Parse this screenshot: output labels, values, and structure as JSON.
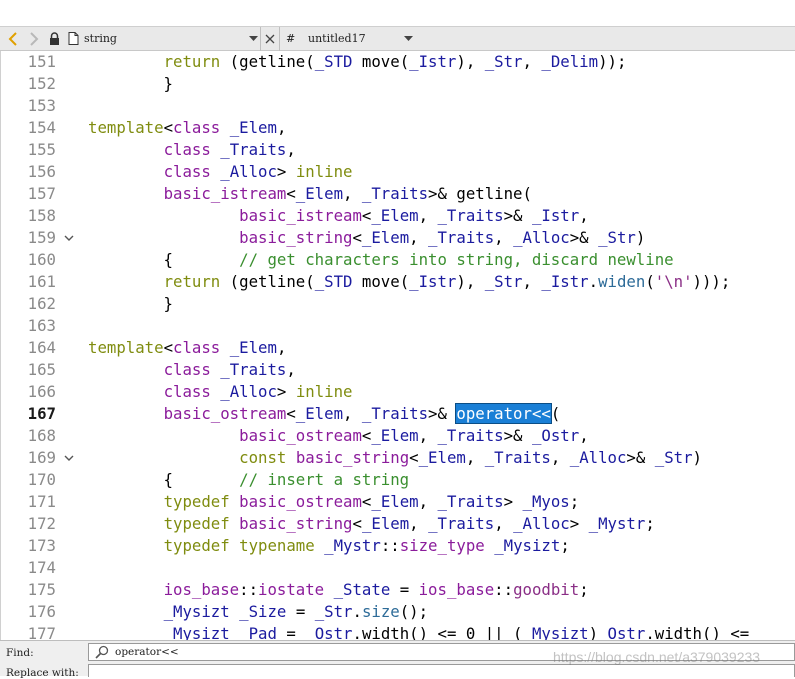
{
  "colors": {
    "keyword": "#7f8c0f",
    "type": "#8b1c9b",
    "identifier": "#1b1b9f",
    "comment": "#3a8f2f",
    "string": "#8a2e86",
    "method": "#2d6b98",
    "plain": "#000000",
    "selection": "#1a7fd6"
  },
  "toolbar": {
    "back_icon": "chevron-left-icon",
    "forward_icon": "chevron-right-icon",
    "lock_icon": "lock-icon",
    "file_icon": "file-icon",
    "file_name": "string",
    "symbol_prefix": "#",
    "symbol_name": "untitled17"
  },
  "editor": {
    "lines": [
      {
        "n": "151",
        "fold": "",
        "tokens": [
          [
            "        ",
            "p"
          ],
          [
            "return",
            "k"
          ],
          [
            " (getline(",
            "p"
          ],
          [
            "_STD",
            "i"
          ],
          [
            " move(",
            "p"
          ],
          [
            "_Istr",
            "i"
          ],
          [
            "), ",
            "p"
          ],
          [
            "_Str",
            "i"
          ],
          [
            ", ",
            "p"
          ],
          [
            "_Delim",
            "i"
          ],
          [
            "));",
            "p"
          ]
        ]
      },
      {
        "n": "152",
        "fold": "",
        "tokens": [
          [
            "        }",
            "p"
          ]
        ]
      },
      {
        "n": "153",
        "fold": "",
        "tokens": []
      },
      {
        "n": "154",
        "fold": "",
        "tokens": [
          [
            "template",
            "k"
          ],
          [
            "<",
            "p"
          ],
          [
            "class",
            "t"
          ],
          [
            " ",
            "p"
          ],
          [
            "_Elem",
            "i"
          ],
          [
            ",",
            "p"
          ]
        ]
      },
      {
        "n": "155",
        "fold": "",
        "tokens": [
          [
            "        ",
            "p"
          ],
          [
            "class",
            "t"
          ],
          [
            " ",
            "p"
          ],
          [
            "_Traits",
            "i"
          ],
          [
            ",",
            "p"
          ]
        ]
      },
      {
        "n": "156",
        "fold": "",
        "tokens": [
          [
            "        ",
            "p"
          ],
          [
            "class",
            "t"
          ],
          [
            " ",
            "p"
          ],
          [
            "_Alloc",
            "i"
          ],
          [
            "> ",
            "p"
          ],
          [
            "inline",
            "k"
          ]
        ]
      },
      {
        "n": "157",
        "fold": "",
        "tokens": [
          [
            "        ",
            "p"
          ],
          [
            "basic_istream",
            "t"
          ],
          [
            "<",
            "p"
          ],
          [
            "_Elem",
            "i"
          ],
          [
            ", ",
            "p"
          ],
          [
            "_Traits",
            "i"
          ],
          [
            ">& getline(",
            "p"
          ]
        ]
      },
      {
        "n": "158",
        "fold": "",
        "tokens": [
          [
            "                ",
            "p"
          ],
          [
            "basic_istream",
            "t"
          ],
          [
            "<",
            "p"
          ],
          [
            "_Elem",
            "i"
          ],
          [
            ", ",
            "p"
          ],
          [
            "_Traits",
            "i"
          ],
          [
            ">& ",
            "p"
          ],
          [
            "_Istr",
            "i"
          ],
          [
            ",",
            "p"
          ]
        ]
      },
      {
        "n": "159",
        "fold": "v",
        "tokens": [
          [
            "                ",
            "p"
          ],
          [
            "basic_string",
            "t"
          ],
          [
            "<",
            "p"
          ],
          [
            "_Elem",
            "i"
          ],
          [
            ", ",
            "p"
          ],
          [
            "_Traits",
            "i"
          ],
          [
            ", ",
            "p"
          ],
          [
            "_Alloc",
            "i"
          ],
          [
            ">& ",
            "p"
          ],
          [
            "_Str",
            "i"
          ],
          [
            ")",
            "p"
          ]
        ]
      },
      {
        "n": "160",
        "fold": "",
        "tokens": [
          [
            "        {       ",
            "p"
          ],
          [
            "// get characters into string, discard newline",
            "c"
          ]
        ]
      },
      {
        "n": "161",
        "fold": "",
        "tokens": [
          [
            "        ",
            "p"
          ],
          [
            "return",
            "k"
          ],
          [
            " (getline(",
            "p"
          ],
          [
            "_STD",
            "i"
          ],
          [
            " move(",
            "p"
          ],
          [
            "_Istr",
            "i"
          ],
          [
            "), ",
            "p"
          ],
          [
            "_Str",
            "i"
          ],
          [
            ", ",
            "p"
          ],
          [
            "_Istr",
            "i"
          ],
          [
            ".",
            "p"
          ],
          [
            "widen",
            "m"
          ],
          [
            "(",
            "p"
          ],
          [
            "'\\n'",
            "s"
          ],
          [
            ")));",
            "p"
          ]
        ]
      },
      {
        "n": "162",
        "fold": "",
        "tokens": [
          [
            "        }",
            "p"
          ]
        ]
      },
      {
        "n": "163",
        "fold": "",
        "tokens": []
      },
      {
        "n": "164",
        "fold": "",
        "tokens": [
          [
            "template",
            "k"
          ],
          [
            "<",
            "p"
          ],
          [
            "class",
            "t"
          ],
          [
            " ",
            "p"
          ],
          [
            "_Elem",
            "i"
          ],
          [
            ",",
            "p"
          ]
        ]
      },
      {
        "n": "165",
        "fold": "",
        "tokens": [
          [
            "        ",
            "p"
          ],
          [
            "class",
            "t"
          ],
          [
            " ",
            "p"
          ],
          [
            "_Traits",
            "i"
          ],
          [
            ",",
            "p"
          ]
        ]
      },
      {
        "n": "166",
        "fold": "",
        "tokens": [
          [
            "        ",
            "p"
          ],
          [
            "class",
            "t"
          ],
          [
            " ",
            "p"
          ],
          [
            "_Alloc",
            "i"
          ],
          [
            "> ",
            "p"
          ],
          [
            "inline",
            "k"
          ]
        ]
      },
      {
        "n": "167",
        "fold": "",
        "cur": true,
        "tokens": [
          [
            "        ",
            "p"
          ],
          [
            "basic_ostream",
            "t"
          ],
          [
            "<",
            "p"
          ],
          [
            "_Elem",
            "i"
          ],
          [
            ", ",
            "p"
          ],
          [
            "_Traits",
            "i"
          ],
          [
            ">& ",
            "p"
          ],
          [
            "operator<<",
            "sel"
          ],
          [
            "(",
            "p"
          ]
        ]
      },
      {
        "n": "168",
        "fold": "",
        "tokens": [
          [
            "                ",
            "p"
          ],
          [
            "basic_ostream",
            "t"
          ],
          [
            "<",
            "p"
          ],
          [
            "_Elem",
            "i"
          ],
          [
            ", ",
            "p"
          ],
          [
            "_Traits",
            "i"
          ],
          [
            ">& ",
            "p"
          ],
          [
            "_Ostr",
            "i"
          ],
          [
            ",",
            "p"
          ]
        ]
      },
      {
        "n": "169",
        "fold": "v",
        "tokens": [
          [
            "                ",
            "p"
          ],
          [
            "const",
            "k"
          ],
          [
            " ",
            "p"
          ],
          [
            "basic_string",
            "t"
          ],
          [
            "<",
            "p"
          ],
          [
            "_Elem",
            "i"
          ],
          [
            ", ",
            "p"
          ],
          [
            "_Traits",
            "i"
          ],
          [
            ", ",
            "p"
          ],
          [
            "_Alloc",
            "i"
          ],
          [
            ">& ",
            "p"
          ],
          [
            "_Str",
            "i"
          ],
          [
            ")",
            "p"
          ]
        ]
      },
      {
        "n": "170",
        "fold": "",
        "tokens": [
          [
            "        {       ",
            "p"
          ],
          [
            "// insert a string",
            "c"
          ]
        ]
      },
      {
        "n": "171",
        "fold": "",
        "tokens": [
          [
            "        ",
            "p"
          ],
          [
            "typedef",
            "k"
          ],
          [
            " ",
            "p"
          ],
          [
            "basic_ostream",
            "t"
          ],
          [
            "<",
            "p"
          ],
          [
            "_Elem",
            "i"
          ],
          [
            ", ",
            "p"
          ],
          [
            "_Traits",
            "i"
          ],
          [
            "> ",
            "p"
          ],
          [
            "_Myos",
            "i"
          ],
          [
            ";",
            "p"
          ]
        ]
      },
      {
        "n": "172",
        "fold": "",
        "tokens": [
          [
            "        ",
            "p"
          ],
          [
            "typedef",
            "k"
          ],
          [
            " ",
            "p"
          ],
          [
            "basic_string",
            "t"
          ],
          [
            "<",
            "p"
          ],
          [
            "_Elem",
            "i"
          ],
          [
            ", ",
            "p"
          ],
          [
            "_Traits",
            "i"
          ],
          [
            ", ",
            "p"
          ],
          [
            "_Alloc",
            "i"
          ],
          [
            "> ",
            "p"
          ],
          [
            "_Mystr",
            "i"
          ],
          [
            ";",
            "p"
          ]
        ]
      },
      {
        "n": "173",
        "fold": "",
        "tokens": [
          [
            "        ",
            "p"
          ],
          [
            "typedef",
            "k"
          ],
          [
            " ",
            "p"
          ],
          [
            "typename",
            "k"
          ],
          [
            " ",
            "p"
          ],
          [
            "_Mystr",
            "i"
          ],
          [
            "::",
            "p"
          ],
          [
            "size_type",
            "t"
          ],
          [
            " ",
            "p"
          ],
          [
            "_Mysizt",
            "i"
          ],
          [
            ";",
            "p"
          ]
        ]
      },
      {
        "n": "174",
        "fold": "",
        "tokens": []
      },
      {
        "n": "175",
        "fold": "",
        "tokens": [
          [
            "        ",
            "p"
          ],
          [
            "ios_base",
            "t"
          ],
          [
            "::",
            "p"
          ],
          [
            "iostate",
            "t"
          ],
          [
            " ",
            "p"
          ],
          [
            "_State",
            "i"
          ],
          [
            " = ",
            "p"
          ],
          [
            "ios_base",
            "t"
          ],
          [
            "::",
            "p"
          ],
          [
            "goodbit",
            "s"
          ],
          [
            ";",
            "p"
          ]
        ]
      },
      {
        "n": "176",
        "fold": "",
        "tokens": [
          [
            "        ",
            "p"
          ],
          [
            "_Mysizt",
            "i"
          ],
          [
            " ",
            "p"
          ],
          [
            "_Size",
            "i"
          ],
          [
            " = ",
            "p"
          ],
          [
            "_Str",
            "i"
          ],
          [
            ".",
            "p"
          ],
          [
            "size",
            "m"
          ],
          [
            "();",
            "p"
          ]
        ]
      },
      {
        "n": "177",
        "fold": "",
        "tokens": [
          [
            "        ",
            "p"
          ],
          [
            "_Mysizt",
            "i"
          ],
          [
            " ",
            "p"
          ],
          [
            "_Pad",
            "i"
          ],
          [
            " = ",
            "p"
          ],
          [
            "_Ostr",
            "i"
          ],
          [
            ".width() <= 0 || (",
            "p"
          ],
          [
            "_Mysizt",
            "i"
          ],
          [
            ")",
            "p"
          ],
          [
            "_Ostr",
            "i"
          ],
          [
            ".width() <= ",
            "p"
          ]
        ]
      }
    ]
  },
  "findbar": {
    "find_label": "Find:",
    "find_icon": "search-icon",
    "find_value": "operator<<",
    "replace_label": "Replace with:",
    "watermark": "https://blog.csdn.net/a379039233"
  }
}
